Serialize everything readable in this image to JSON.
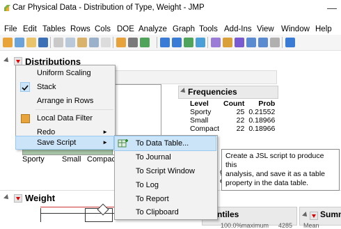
{
  "window": {
    "title": "Car Physical Data - Distribution of Type, Weight - JMP",
    "minimize": "—"
  },
  "menubar": [
    "File",
    "Edit",
    "Tables",
    "Rows",
    "Cols",
    "DOE",
    "Analyze",
    "Graph",
    "Tools",
    "Add-Ins",
    "View",
    "Window",
    "Help"
  ],
  "report": {
    "distributions_title": "Distributions",
    "frequencies": {
      "title": "Frequencies",
      "headers": [
        "Level",
        "Count",
        "Prob"
      ],
      "rows": [
        [
          "Sporty",
          "25",
          "0.21552"
        ],
        [
          "Small",
          "22",
          "0.18966"
        ],
        [
          "Compact",
          "22",
          "0.18966"
        ]
      ],
      "missing_value": "0",
      "tail_g": "g",
      "tail_levels": "evels"
    },
    "axis_categories": [
      "Sporty",
      "Small",
      "Compact"
    ],
    "weight_title": "Weight",
    "quantiles_title": "ntiles",
    "quantiles_row": [
      "100.0%",
      "maximum",
      "4285"
    ],
    "summary_title": "Summ",
    "summary_first": "Mean"
  },
  "context_menu": {
    "items": [
      {
        "label": "Uniform Scaling",
        "checked": false,
        "icon": null,
        "submenu": false
      },
      {
        "label": "Stack",
        "checked": true,
        "icon": null,
        "submenu": false
      },
      {
        "label": "Arrange in Rows",
        "checked": false,
        "icon": null,
        "submenu": false
      },
      {
        "label": "Local Data Filter",
        "checked": false,
        "icon": "filter-icon",
        "submenu": false
      },
      {
        "label": "Redo",
        "checked": false,
        "icon": null,
        "submenu": true
      },
      {
        "label": "Save Script",
        "checked": false,
        "icon": null,
        "submenu": true,
        "highlighted": true
      }
    ]
  },
  "submenu": {
    "items": [
      {
        "label": "To Data Table...",
        "highlighted": true,
        "icon": "add-table-icon"
      },
      {
        "label": "To Journal"
      },
      {
        "label": "To Script Window"
      },
      {
        "label": "To Log"
      },
      {
        "label": "To Report"
      },
      {
        "label": "To Clipboard"
      }
    ]
  },
  "tooltip": {
    "lines": [
      "Create a JSL script to produce this",
      "analysis, and save it as a table",
      "property in the data table."
    ]
  }
}
